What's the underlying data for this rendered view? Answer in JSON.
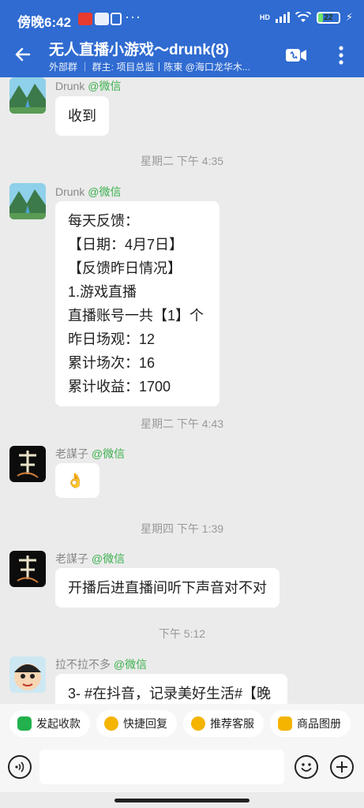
{
  "status_bar": {
    "time": "傍晚6:42",
    "dots": "···",
    "network": "HD",
    "battery": "22",
    "battery_level": 0.22
  },
  "header": {
    "title": "无人直播小游戏～drunk(8)",
    "subtitle": "外部群 ｜ 群主: 项目总监丨陈東 @海口龙华木...",
    "back_icon": "arrow-left-icon",
    "video_icon": "video-call-icon",
    "more_icon": "more-vertical-icon"
  },
  "messages": [
    {
      "sender": "Drunk",
      "source": "@微信",
      "text": [
        "收到"
      ]
    },
    {
      "timestamp": "星期二  下午 4:35"
    },
    {
      "sender": "Drunk",
      "source": "@微信",
      "text": [
        "每天反馈：",
        "【日期：4月7日】",
        "【反馈昨日情况】",
        "1.游戏直播",
        "直播账号一共【1】个",
        "昨日场观：12",
        "累计场次：16",
        "累计收益：1700"
      ]
    },
    {
      "timestamp": "星期二  下午 4:43"
    },
    {
      "sender": "老謀子",
      "source": "@微信",
      "text": [
        "👌"
      ]
    },
    {
      "timestamp": "星期四  下午 1:39"
    },
    {
      "sender": "老謀子",
      "source": "@微信",
      "text": [
        "开播后进直播间听下声音对不对"
      ]
    },
    {
      "timestamp": "下午 5:12"
    },
    {
      "sender": "拉不拉不多",
      "source": "@微信",
      "text": [
        "3- #在抖音，记录美好生活#【晚"
      ]
    }
  ],
  "quick_actions": [
    {
      "label": "发起收款",
      "icon": "payment-icon",
      "color": "#22b14c"
    },
    {
      "label": "快捷回复",
      "icon": "quick-reply-icon",
      "color": "#f4b400"
    },
    {
      "label": "推荐客服",
      "icon": "customer-service-icon",
      "color": "#f4b400"
    },
    {
      "label": "商品图册",
      "icon": "catalog-icon",
      "color": "#f4b400"
    }
  ],
  "composer": {
    "placeholder": "",
    "voice_icon": "voice-icon",
    "emoji_icon": "emoji-icon",
    "plus_icon": "plus-icon"
  },
  "colors": {
    "header": "#2f6bd1",
    "source_tag": "#3bb04e",
    "chat_bg": "#ebebeb"
  }
}
